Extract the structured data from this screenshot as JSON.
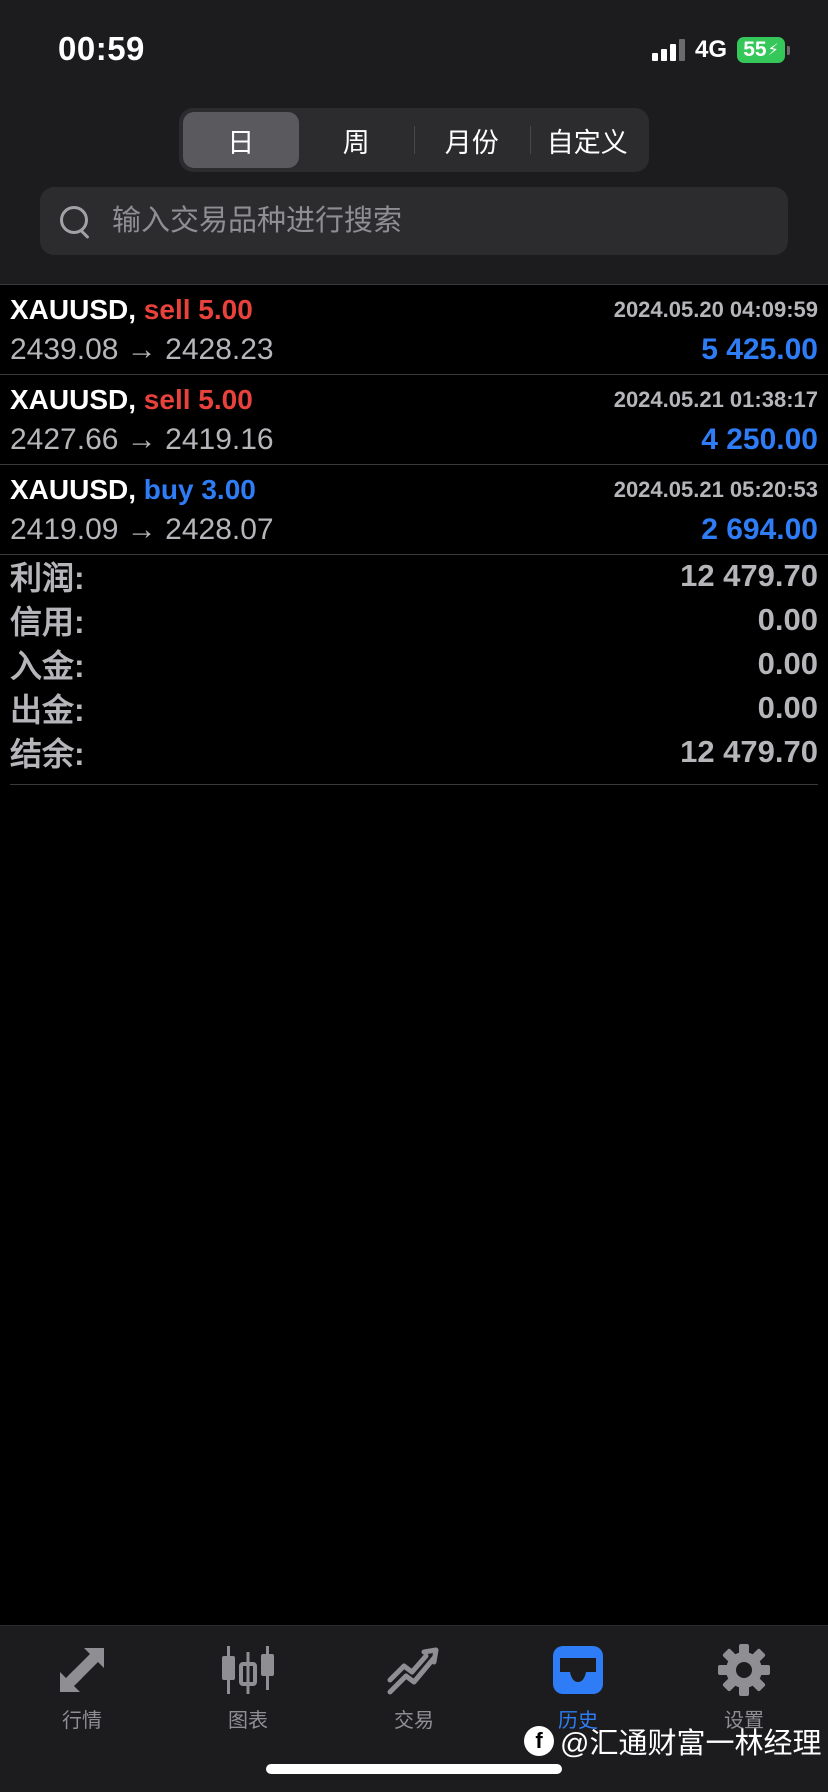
{
  "status": {
    "time": "00:59",
    "network": "4G",
    "battery": "55"
  },
  "segments": [
    "日",
    "周",
    "月份",
    "自定义"
  ],
  "search": {
    "placeholder": "输入交易品种进行搜索"
  },
  "trades": [
    {
      "symbol": "XAUUSD,",
      "side": "sell",
      "volume": "5.00",
      "time": "2024.05.20 04:09:59",
      "open": "2439.08",
      "close": "2428.23",
      "profit": "5 425.00"
    },
    {
      "symbol": "XAUUSD,",
      "side": "sell",
      "volume": "5.00",
      "time": "2024.05.21 01:38:17",
      "open": "2427.66",
      "close": "2419.16",
      "profit": "4 250.00"
    },
    {
      "symbol": "XAUUSD,",
      "side": "buy",
      "volume": "3.00",
      "time": "2024.05.21 05:20:53",
      "open": "2419.09",
      "close": "2428.07",
      "profit": "2 694.00"
    }
  ],
  "arrow": "→",
  "summary": [
    {
      "label": "利润:",
      "value": "12 479.70"
    },
    {
      "label": "信用:",
      "value": "0.00"
    },
    {
      "label": "入金:",
      "value": "0.00"
    },
    {
      "label": "出金:",
      "value": "0.00"
    },
    {
      "label": "结余:",
      "value": "12 479.70"
    }
  ],
  "tabs": [
    {
      "label": "行情",
      "icon": "quotes-arrows-icon"
    },
    {
      "label": "图表",
      "icon": "candlestick-chart-icon"
    },
    {
      "label": "交易",
      "icon": "trade-trend-icon"
    },
    {
      "label": "历史",
      "icon": "history-inbox-icon",
      "active": true
    },
    {
      "label": "设置",
      "icon": "gear-icon"
    }
  ],
  "watermark": {
    "text": "@汇通财富一林经理",
    "icon": "facebook-icon"
  },
  "colors": {
    "sell": "#e9413b",
    "buy": "#2f7df6",
    "profit": "#2f7df6",
    "battery": "#35c759"
  }
}
